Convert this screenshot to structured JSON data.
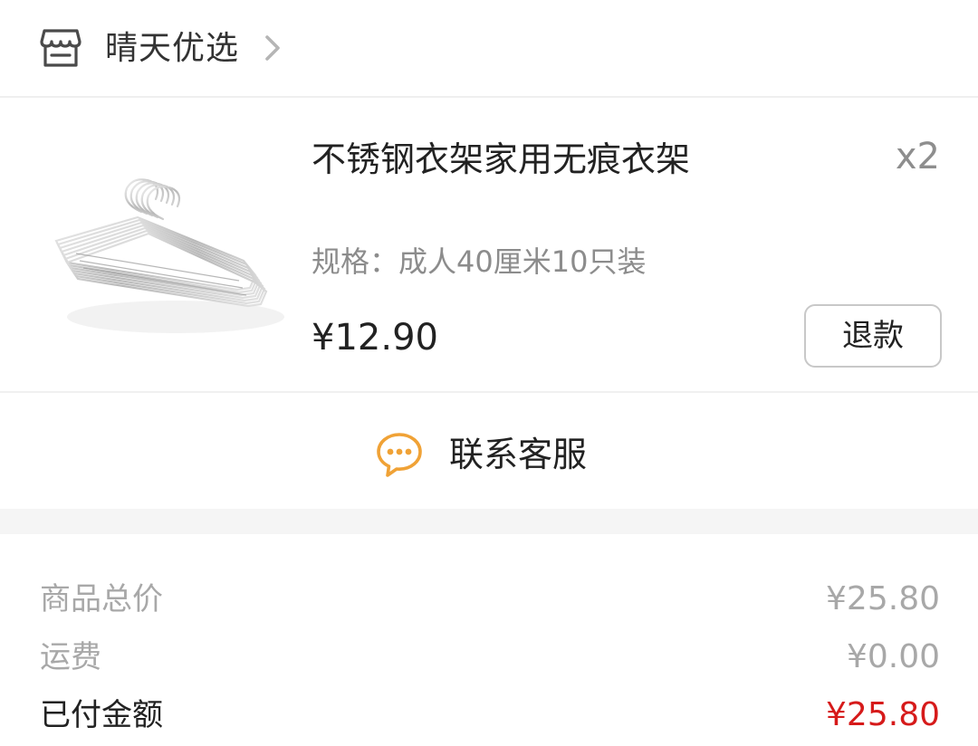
{
  "store": {
    "name": "晴天优选",
    "icon": "store-icon"
  },
  "product": {
    "title": "不锈钢衣架家用无痕衣架",
    "quantity": "x2",
    "spec": "规格：成人40厘米10只装",
    "price": "¥12.90",
    "refund_label": "退款",
    "image": "clothes-hangers-image"
  },
  "contact": {
    "label": "联系客服",
    "icon": "chat-bubble-icon",
    "icon_color": "#f0a236"
  },
  "summary": {
    "subtotal_label": "商品总价",
    "subtotal_value": "¥25.80",
    "shipping_label": "运费",
    "shipping_value": "¥0.00",
    "paid_label": "已付金额",
    "paid_value": "¥25.80",
    "accent_color": "#d61a1a"
  }
}
